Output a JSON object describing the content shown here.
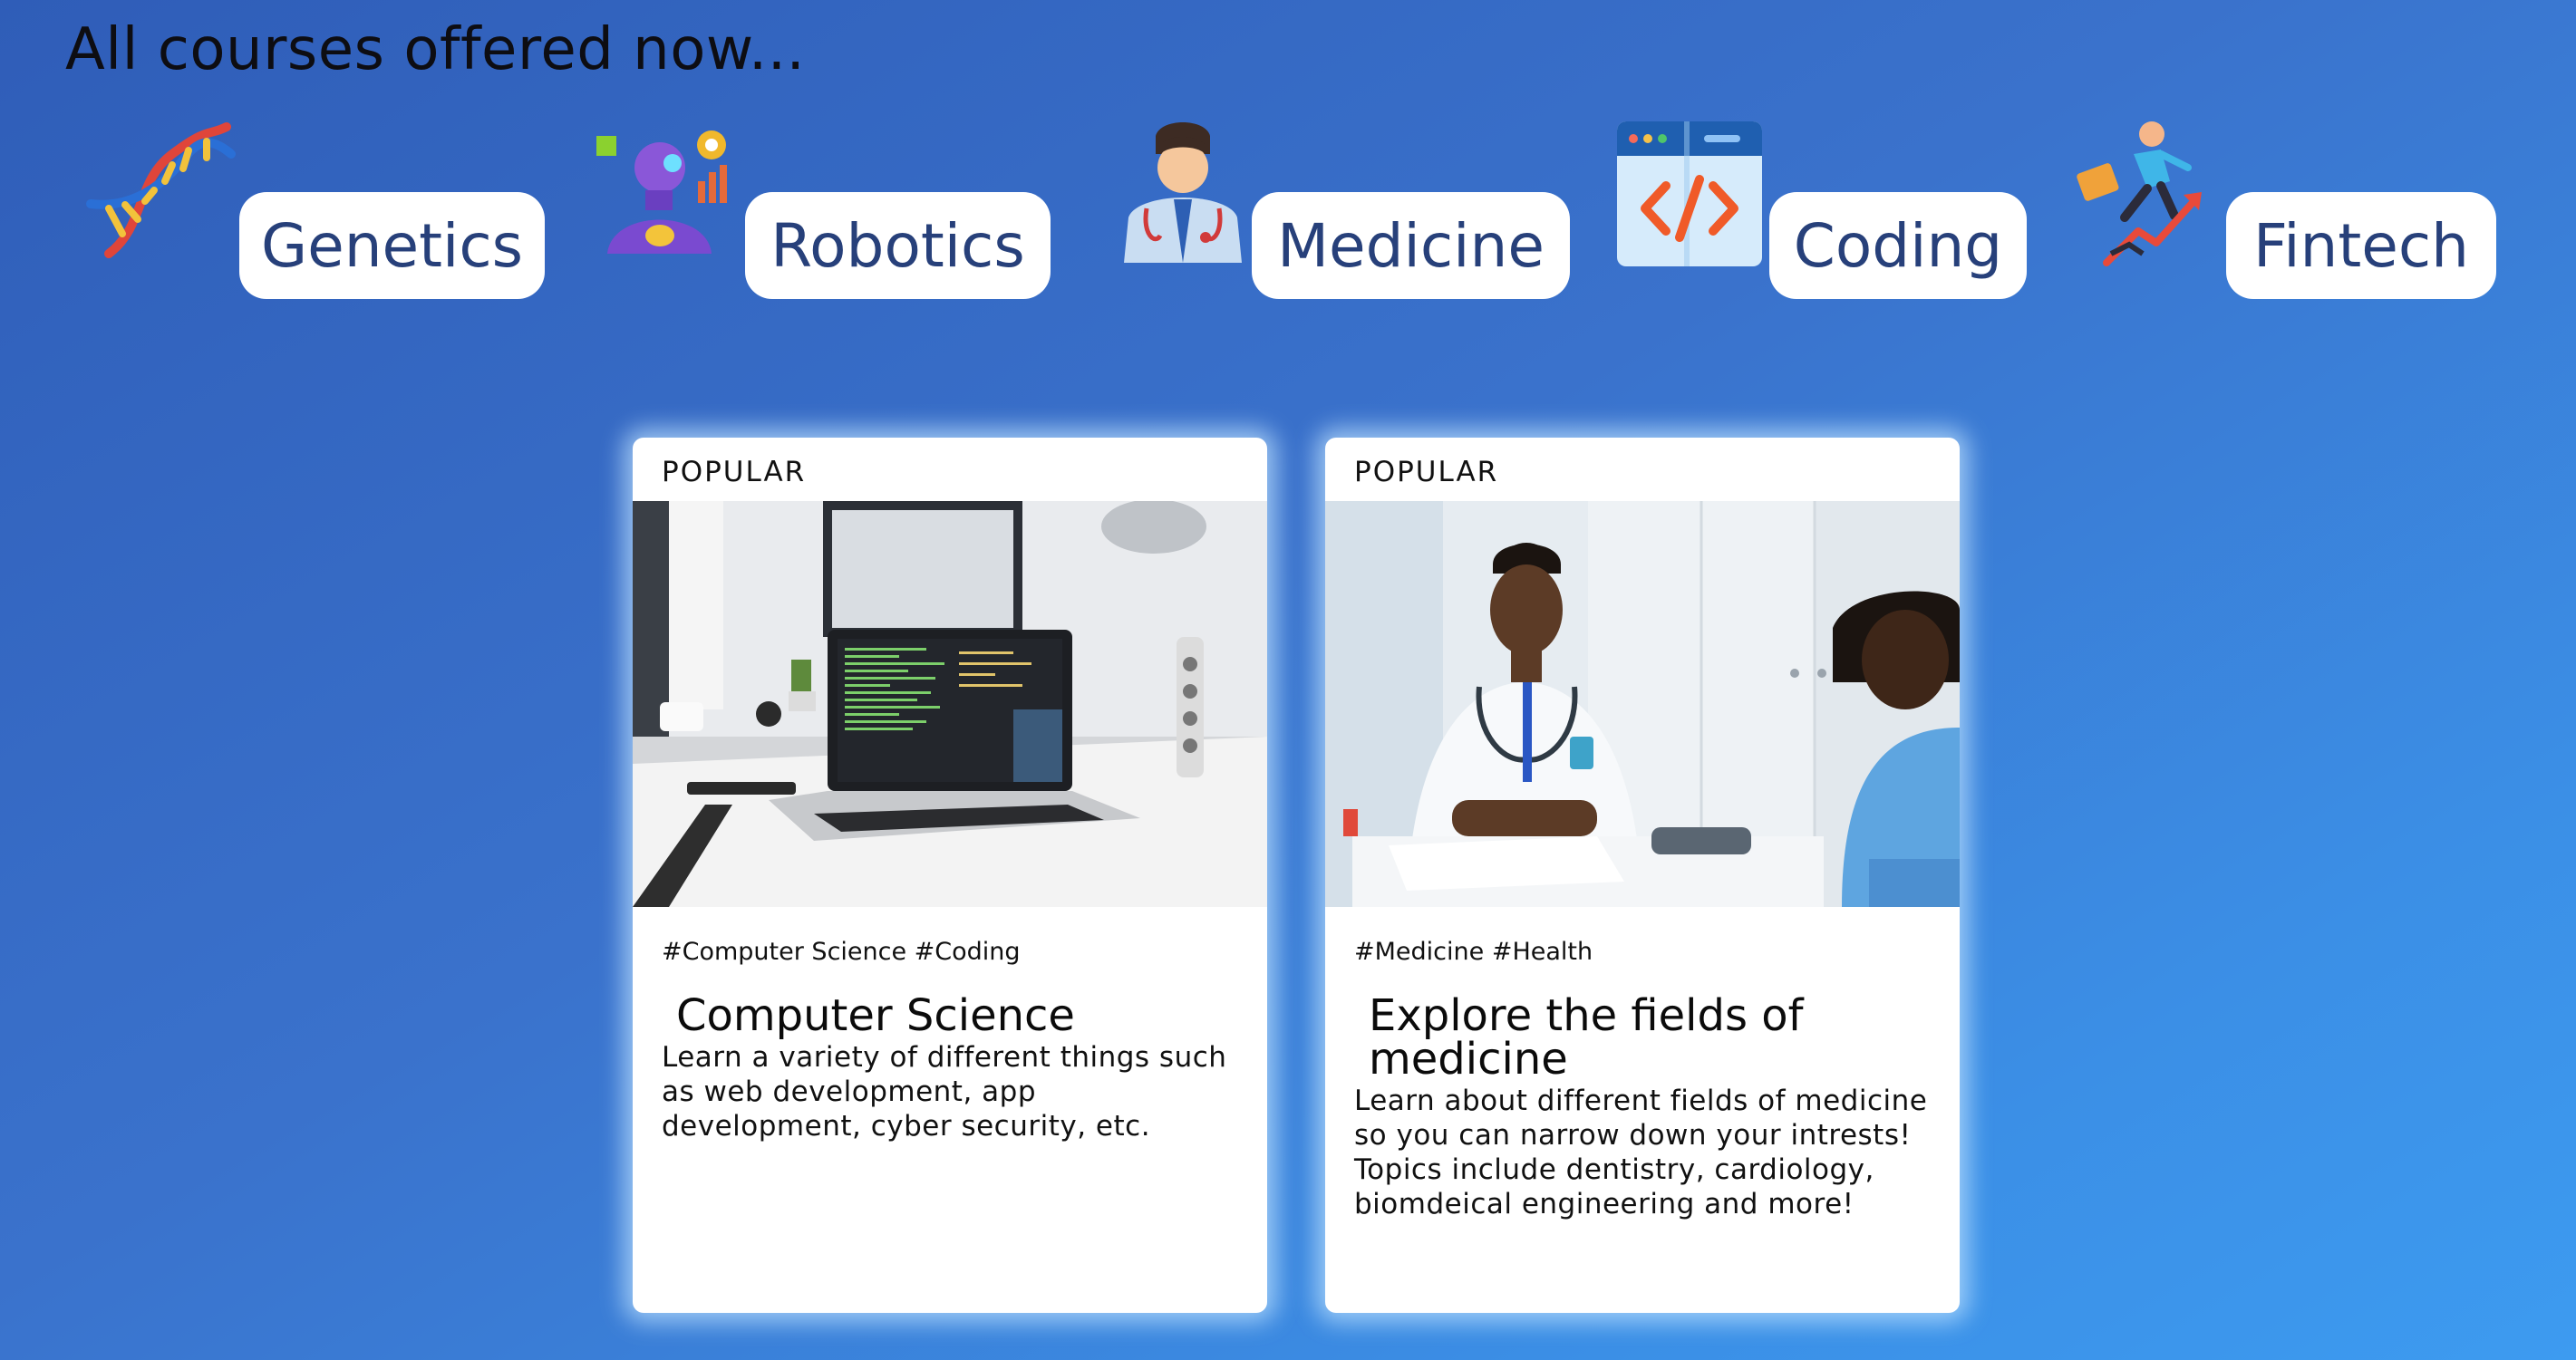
{
  "page": {
    "title": "All courses offered now..."
  },
  "categories": [
    {
      "label": "Genetics",
      "icon": "dna-icon"
    },
    {
      "label": "Robotics",
      "icon": "robot-icon"
    },
    {
      "label": "Medicine",
      "icon": "doctor-icon"
    },
    {
      "label": "Coding",
      "icon": "code-window-icon"
    },
    {
      "label": "Fintech",
      "icon": "rising-businessman-icon"
    }
  ],
  "cards": [
    {
      "badge": "POPULAR",
      "image": "laptop-with-code-on-desk-photo",
      "tags": "#Computer Science #Coding",
      "title": "Computer Science",
      "description": "Learn a variety of different things such as web development, app development, cyber security, etc."
    },
    {
      "badge": "POPULAR",
      "image": "doctor-with-child-patient-photo",
      "tags": "#Medicine #Health",
      "title": "Explore the fields of medicine",
      "description": "Learn about different fields of medicine so you can narrow down your intrests! Topics include dentistry, cardiology, biomdeical engineering and more!"
    }
  ],
  "colors": {
    "pill_text": "#27407a",
    "background_start": "#2f5db8",
    "background_end": "#3d9bf0",
    "card_glow": "#bee1ff"
  }
}
